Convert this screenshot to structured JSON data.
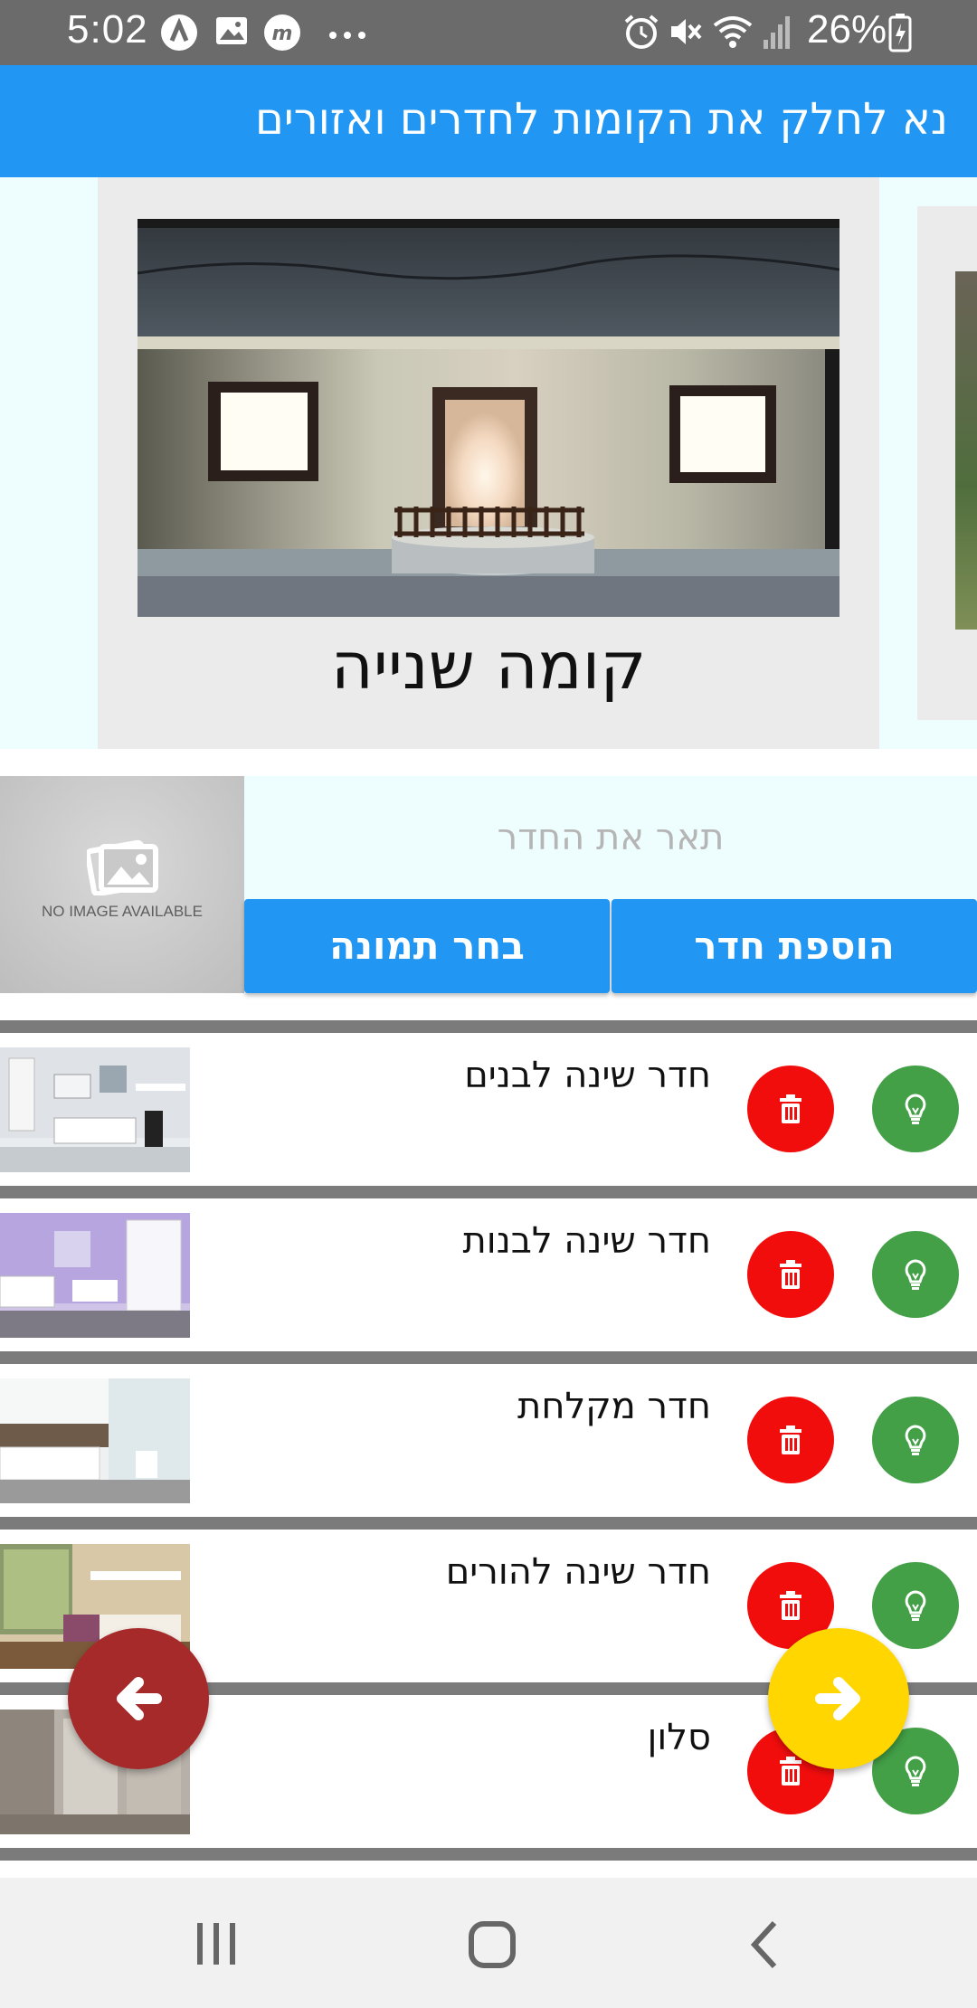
{
  "status_bar": {
    "time": "5:02",
    "battery": "26%",
    "icons": [
      "a-icon",
      "gallery-icon",
      "m-icon",
      "more-icon",
      "alarm-icon",
      "mute-icon",
      "wifi-icon",
      "signal-icon",
      "battery-icon"
    ]
  },
  "app_bar": {
    "title": "נא לחלק את הקומות לחדרים ואזורים"
  },
  "carousel": {
    "current_floor": {
      "name": "קומה שנייה"
    }
  },
  "room_form": {
    "no_image_text": "NO IMAGE AVAILABLE",
    "description_placeholder": "תאר את החדר",
    "description_value": "",
    "choose_image_label": "בחר תמונה",
    "add_room_label": "הוספת חדר"
  },
  "rooms": [
    {
      "name": "חדר שינה לבנים"
    },
    {
      "name": "חדר שינה לבנות"
    },
    {
      "name": "חדר מקלחת"
    },
    {
      "name": "חדר שינה להורים"
    },
    {
      "name": "סלון"
    }
  ],
  "colors": {
    "primary": "#2196f3",
    "delete": "#f20d0d",
    "bulb": "#43a047",
    "back_fab": "#a62a2a",
    "forward_fab": "#ffd600",
    "carousel_bg": "#eefdfd"
  },
  "nav_bar": {
    "icons": [
      "recent-apps-icon",
      "home-icon",
      "back-icon"
    ]
  }
}
